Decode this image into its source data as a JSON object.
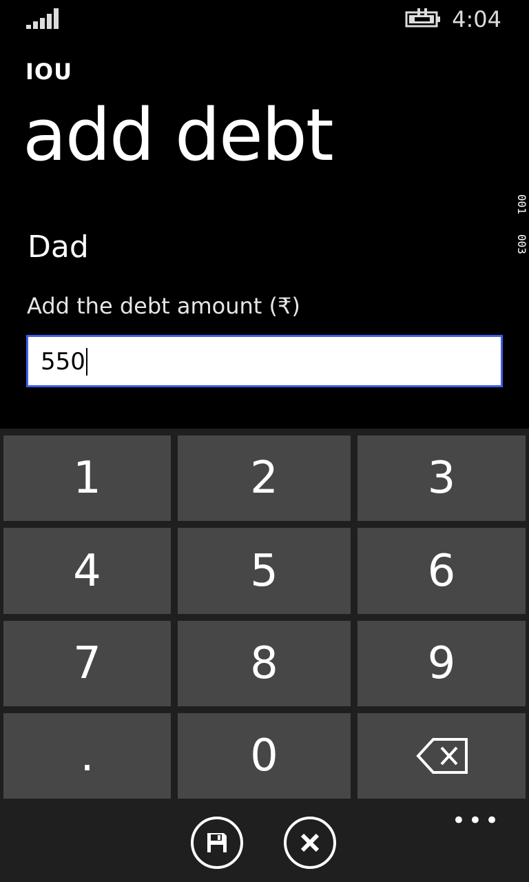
{
  "status": {
    "time": "4:04"
  },
  "header": {
    "app_title": "IOU",
    "page_title": "add debt"
  },
  "debug": {
    "counter_top": "001",
    "counter_bottom": "003"
  },
  "form": {
    "person_name": "Dad",
    "amount_label": "Add the debt amount (₹)",
    "amount_value": "550"
  },
  "keypad": {
    "keys": [
      "1",
      "2",
      "3",
      "4",
      "5",
      "6",
      "7",
      "8",
      "9",
      ".",
      "0"
    ],
    "backspace_icon": "backspace-icon"
  },
  "appbar": {
    "buttons": [
      "save-icon",
      "cancel-icon"
    ],
    "more": "•••"
  },
  "colors": {
    "accent": "#3F5EE6",
    "key": "#474747",
    "keyboard_bg": "#1f1f1f"
  }
}
